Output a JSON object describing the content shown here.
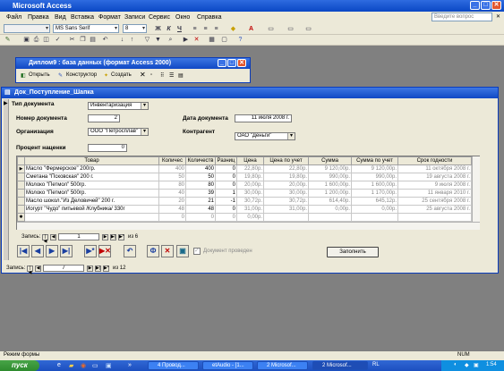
{
  "app": {
    "title": "Microsoft Access",
    "help_placeholder": "Введите вопрос"
  },
  "menu": [
    "Файл",
    "Правка",
    "Вид",
    "Вставка",
    "Формат",
    "Записи",
    "Сервис",
    "Окно",
    "Справка"
  ],
  "toolbar": {
    "font_name": "MS Sans Serif",
    "font_size": "8"
  },
  "db_window": {
    "title": "Диплом9 : база данных (формат Access 2000)",
    "open_label": "Открыть",
    "design_label": "Конструктор",
    "create_label": "Создать"
  },
  "form": {
    "title": "Док_Поступление_Шапка",
    "doc_type_label": "Тип документа",
    "doc_type_value": "Инвентаризация",
    "doc_number_label": "Номер документа",
    "doc_number_value": "2",
    "doc_date_label": "Дата документа",
    "doc_date_value": "11 июля 2008 г.",
    "org_label": "Организация",
    "org_value": "ООО \"Петросплав\"",
    "counterparty_label": "Контрагент",
    "counterparty_value": "ОАО \"Деньги\"",
    "markup_label": "Процент наценки",
    "markup_value": "0",
    "posted_label": "Документ проведен",
    "submit_label": "Заполнить"
  },
  "grid": {
    "columns": [
      "Товар",
      "Количес",
      "Количеств",
      "Разниц",
      "Цена",
      "Цена по учет",
      "Сумма",
      "Сумма по учет",
      "Срок годности"
    ],
    "rows": [
      [
        "Масло \"Фермерское\" 200гр.",
        "400",
        "400",
        "0",
        "22,80р.",
        "22,80р.",
        "9 120,00р.",
        "9 120,00р.",
        "11 октября 2008 г."
      ],
      [
        "Сметана \"Псковская\" 200 г.",
        "50",
        "50",
        "0",
        "19,80р.",
        "19,80р.",
        "990,00р.",
        "990,00р.",
        "19 августа 2008 г."
      ],
      [
        "Молоко \"Петмол\" 500гр.",
        "80",
        "80",
        "0",
        "20,00р.",
        "20,00р.",
        "1 600,00р.",
        "1 600,00р.",
        "9 июля 2008 г."
      ],
      [
        "Молоко \"Петмол\" 500гр.",
        "40",
        "39",
        "1",
        "30,00р.",
        "30,00р.",
        "1 200,00р.",
        "1 170,00р.",
        "11 января 2010 г."
      ],
      [
        "Масло шокол.\"Из Деловичей\" 200 г.",
        "20",
        "21",
        "-1",
        "30,72р.",
        "30,72р.",
        "614,40р.",
        "645,12р.",
        "25 сентября 2008 г."
      ],
      [
        "Йогурт \"Чудо\" питьевой /Клубника/ 330г",
        "48",
        "48",
        "0",
        "31,00р.",
        "31,00р.",
        "0,00р.",
        "0,00р.",
        "25 августа 2008 г."
      ],
      [
        "",
        "0",
        "0",
        "0",
        "0,00р.",
        "",
        "",
        "",
        ""
      ]
    ]
  },
  "sub_nav": {
    "label": "Запись:",
    "current": "1",
    "of_text": "из 6"
  },
  "main_nav": {
    "label": "Запись:",
    "current": "7",
    "of_text": "из 12"
  },
  "status": {
    "left": "Режим формы",
    "right": "NUM"
  },
  "taskbar": {
    "start_label": "пуск",
    "tasks": [
      "4 Провод...",
      "etAudio - [1...",
      "2 Microsof...",
      "2 Microsof..."
    ],
    "lang": "RL",
    "clock": "1:54"
  }
}
